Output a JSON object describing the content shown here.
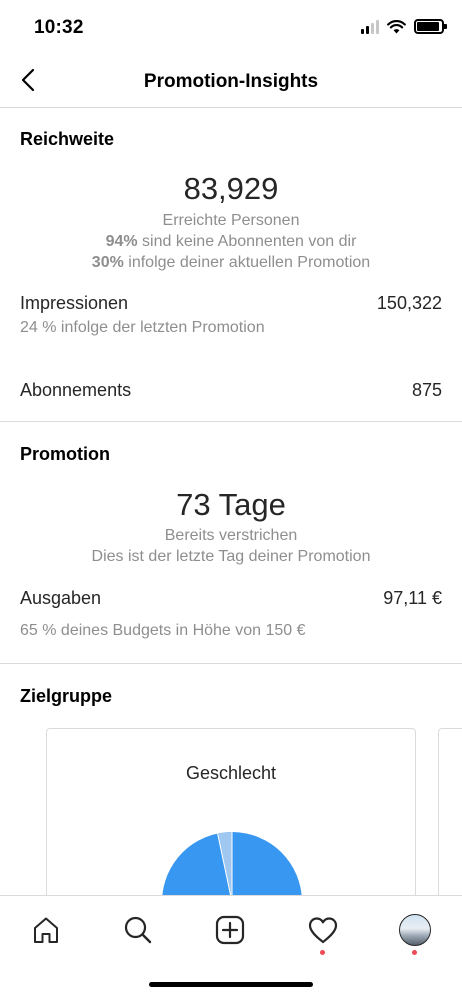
{
  "status_bar": {
    "time": "10:32"
  },
  "header": {
    "title": "Promotion-Insights"
  },
  "reach": {
    "title": "Reichweite",
    "people_count": "83,929",
    "people_label": "Erreichte Personen",
    "non_followers_pct": "94%",
    "non_followers_text": " sind keine Abonnenten von dir",
    "promotion_pct": "30%",
    "promotion_text": " infolge deiner aktuellen Promotion",
    "impressions_label": "Impressionen",
    "impressions_value": "150,322",
    "impressions_sub": "24 % infolge der letzten Promotion",
    "follows_label": "Abonnements",
    "follows_value": "875"
  },
  "promotion": {
    "title": "Promotion",
    "days": "73 Tage",
    "days_label": "Bereits verstrichen",
    "last_day_note": "Dies ist der letzte Tag deiner Promotion",
    "spend_label": "Ausgaben",
    "spend_value": "97,11 €",
    "spend_sub": "65 % deines Budgets in Höhe von 150 €"
  },
  "audience": {
    "title": "Zielgruppe",
    "card_title": "Geschlecht"
  },
  "colors": {
    "accent_blue": "#3897f0",
    "accent_light_blue": "#9fc7ef",
    "notification_red": "#ed4956"
  },
  "tab_bar": {
    "icons": [
      "home-icon",
      "search-icon",
      "new-post-icon",
      "activity-heart-icon",
      "profile-avatar"
    ]
  }
}
